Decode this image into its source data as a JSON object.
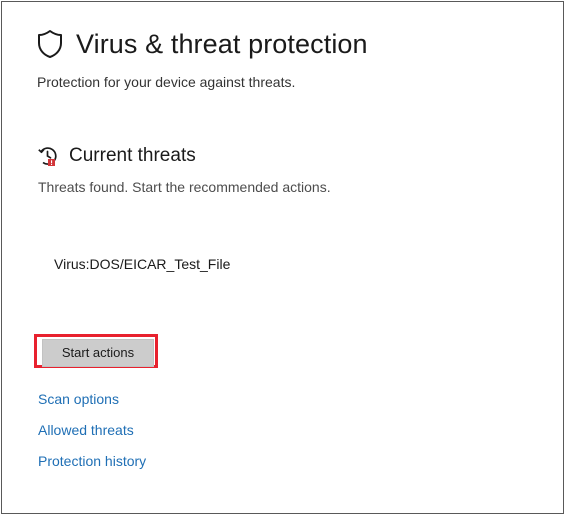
{
  "header": {
    "icon": "shield-icon",
    "title": "Virus & threat protection",
    "subtitle": "Protection for your device against threats."
  },
  "current_threats": {
    "icon": "threat-clock-alert-icon",
    "title": "Current threats",
    "description": "Threats found. Start the recommended actions.",
    "threats": [
      "Virus:DOS/EICAR_Test_File"
    ],
    "action_button_label": "Start actions",
    "highlight_color": "#e8212e"
  },
  "links": [
    {
      "label": "Scan options"
    },
    {
      "label": "Allowed threats"
    },
    {
      "label": "Protection history"
    }
  ],
  "colors": {
    "link": "#1f6fb5",
    "button_bg": "#cccccc",
    "alert_red": "#d13438"
  }
}
